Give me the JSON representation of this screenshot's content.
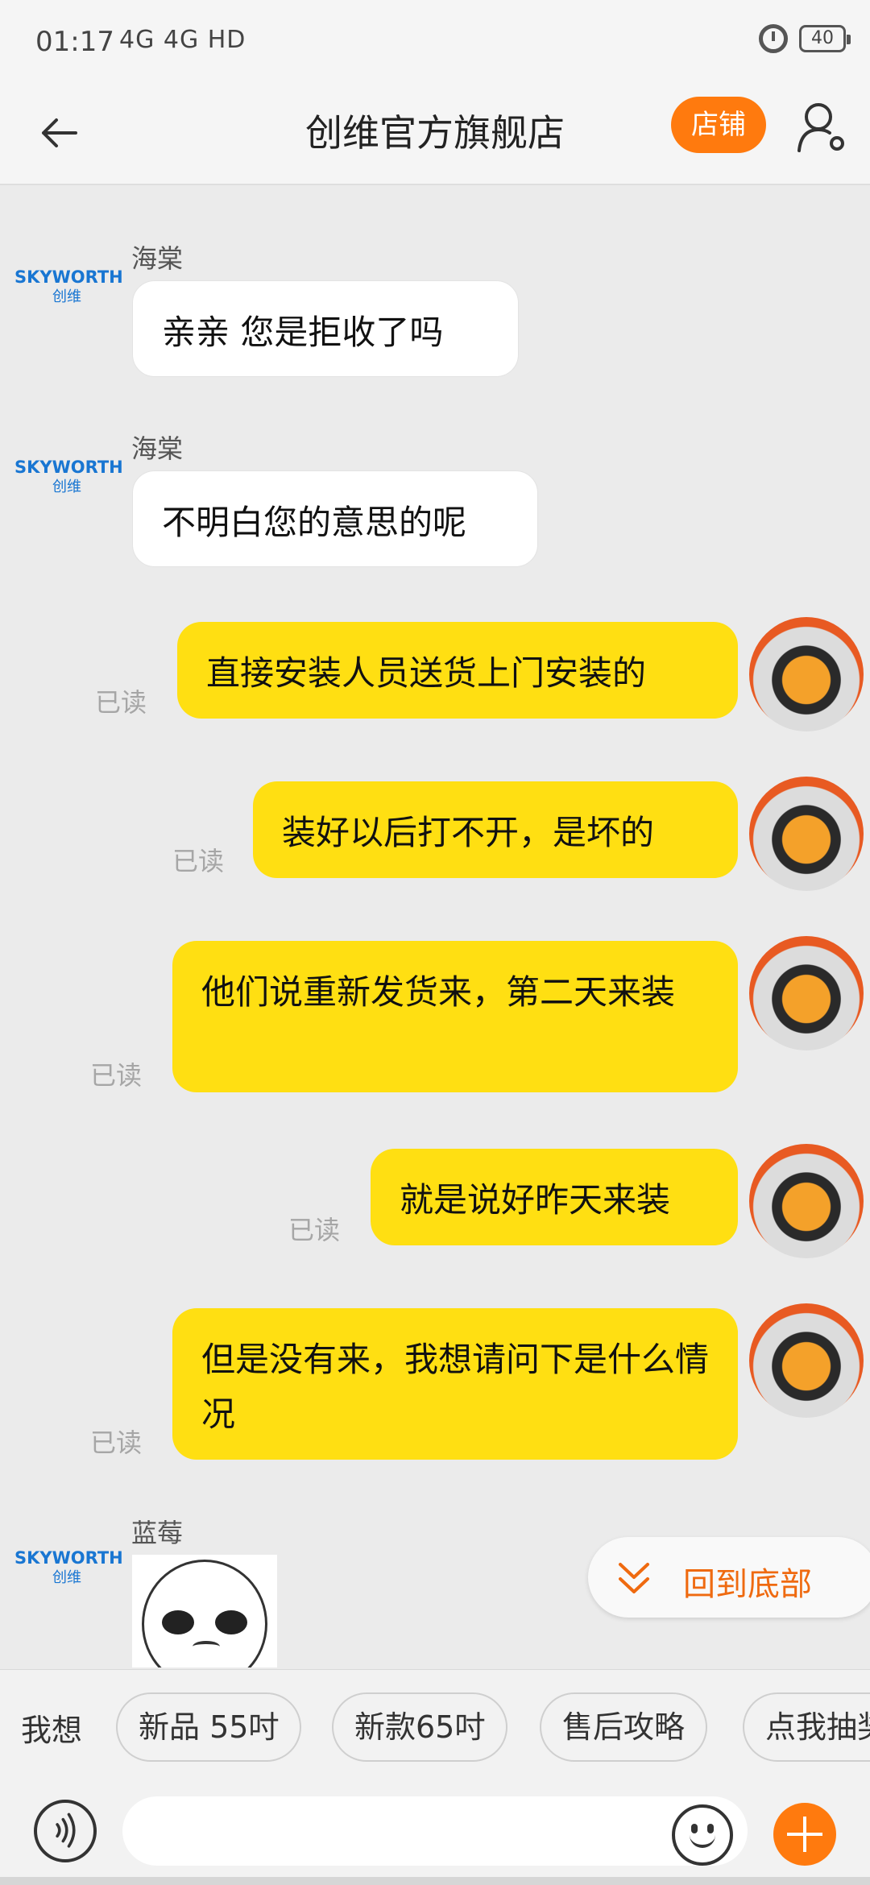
{
  "status": {
    "time": "01:17",
    "network": "4G 4G HD",
    "battery": "40"
  },
  "header": {
    "title": "创维官方旗舰店",
    "shop_button": "店铺"
  },
  "chat": {
    "messages": [
      {
        "direction": "in",
        "sender": "海棠",
        "brand": "SKYWORTH",
        "brand_cn": "创维",
        "text": "亲亲  您是拒收了吗"
      },
      {
        "direction": "in",
        "sender": "海棠",
        "brand": "SKYWORTH",
        "brand_cn": "创维",
        "text": "不明白您的意思的呢"
      },
      {
        "direction": "out",
        "status": "已读",
        "text": "直接安装人员送货上门安装的"
      },
      {
        "direction": "out",
        "status": "已读",
        "text": "装好以后打不开，是坏的"
      },
      {
        "direction": "out",
        "status": "已读",
        "text": "他们说重新发货来，第二天来装"
      },
      {
        "direction": "out",
        "status": "已读",
        "text": "就是说好昨天来装"
      },
      {
        "direction": "out",
        "status": "已读",
        "text": "但是没有来，我想请问下是什么情况"
      },
      {
        "direction": "in",
        "sender": "蓝莓",
        "brand": "SKYWORTH",
        "brand_cn": "创维",
        "sticker": "sad-face-sticker"
      }
    ],
    "back_to_bottom": "回到底部"
  },
  "quick_replies": {
    "label": "我想",
    "chips": [
      "新品 55吋",
      "新款65吋",
      "售后攻略",
      "点我抽奖"
    ]
  },
  "icons": {
    "back": "back-arrow-icon",
    "profile": "person-settings-icon",
    "voice": "voice-icon",
    "emoji": "emoji-icon",
    "plus": "plus-icon"
  },
  "colors": {
    "accent": "#ff7a0e",
    "bubble_out": "#ffdf12",
    "bubble_in": "#ffffff",
    "brand": "#1976d2"
  }
}
